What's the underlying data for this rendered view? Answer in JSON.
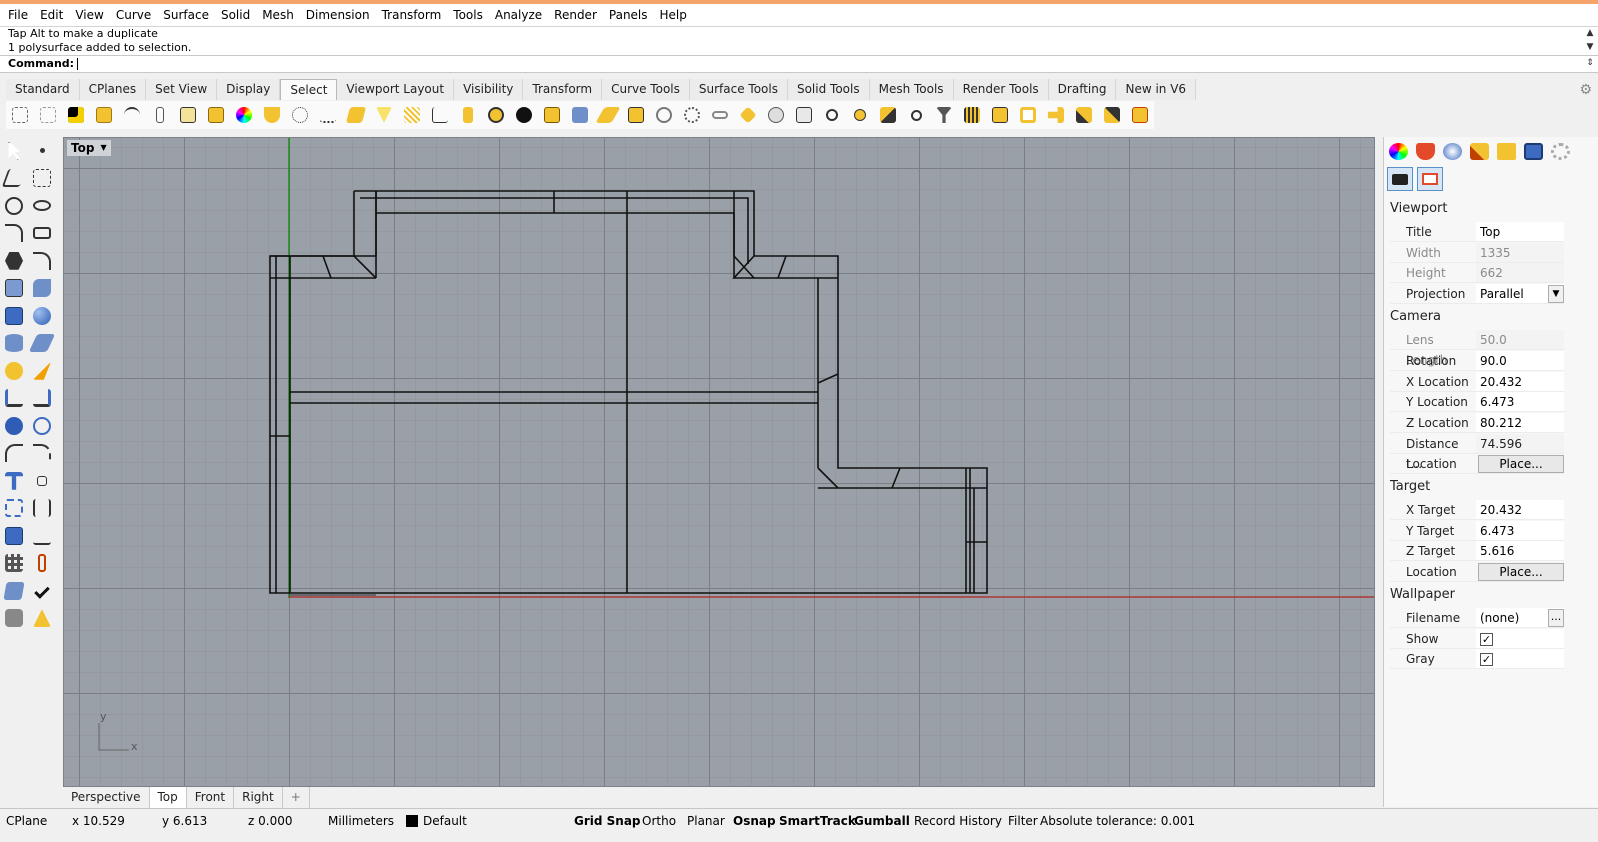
{
  "menu": [
    "File",
    "Edit",
    "View",
    "Curve",
    "Surface",
    "Solid",
    "Mesh",
    "Dimension",
    "Transform",
    "Tools",
    "Analyze",
    "Render",
    "Panels",
    "Help"
  ],
  "command_history": [
    "Tap Alt to make a duplicate",
    "1 polysurface added to selection."
  ],
  "command_prompt": "Command:",
  "toolbar_tabs": [
    "Standard",
    "CPlanes",
    "Set View",
    "Display",
    "Select",
    "Viewport Layout",
    "Visibility",
    "Transform",
    "Curve Tools",
    "Surface Tools",
    "Solid Tools",
    "Mesh Tools",
    "Render Tools",
    "Drafting",
    "New in V6"
  ],
  "active_toolbar_tab": "Select",
  "viewport": {
    "title": "Top",
    "axis_y": "y",
    "axis_x": "x"
  },
  "viewport_tabs": [
    "Perspective",
    "Top",
    "Front",
    "Right",
    "+"
  ],
  "active_viewport_tab": "Top",
  "status_bar": {
    "cplane": "CPlane",
    "x": "x 10.529",
    "y": "y 6.613",
    "z": "z 0.000",
    "units": "Millimeters",
    "layer": "Default",
    "grid_snap": "Grid Snap",
    "ortho": "Ortho",
    "planar": "Planar",
    "osnap": "Osnap",
    "smarttrack": "SmartTrack",
    "gumball": "Gumball",
    "record_history": "Record History",
    "filter": "Filter",
    "tolerance": "Absolute tolerance: 0.001"
  },
  "properties": {
    "viewport_header": "Viewport",
    "title_label": "Title",
    "title_value": "Top",
    "width_label": "Width",
    "width_value": "1335",
    "height_label": "Height",
    "height_value": "662",
    "projection_label": "Projection",
    "projection_value": "Parallel",
    "camera_header": "Camera",
    "lens_label": "Lens Length",
    "lens_value": "50.0",
    "rotation_label": "Rotation",
    "rotation_value": "90.0",
    "xloc_label": "X Location",
    "xloc_value": "20.432",
    "yloc_label": "Y Location",
    "yloc_value": "6.473",
    "zloc_label": "Z Location",
    "zloc_value": "80.212",
    "dist_label": "Distance t...",
    "dist_value": "74.596",
    "loc_label": "Location",
    "loc_button": "Place...",
    "target_header": "Target",
    "xt_label": "X Target",
    "xt_value": "20.432",
    "yt_label": "Y Target",
    "yt_value": "6.473",
    "zt_label": "Z Target",
    "zt_value": "5.616",
    "tloc_label": "Location",
    "tloc_button": "Place...",
    "wallpaper_header": "Wallpaper",
    "filename_label": "Filename",
    "filename_value": "(none)",
    "filename_button": "...",
    "show_label": "Show",
    "gray_label": "Gray"
  }
}
